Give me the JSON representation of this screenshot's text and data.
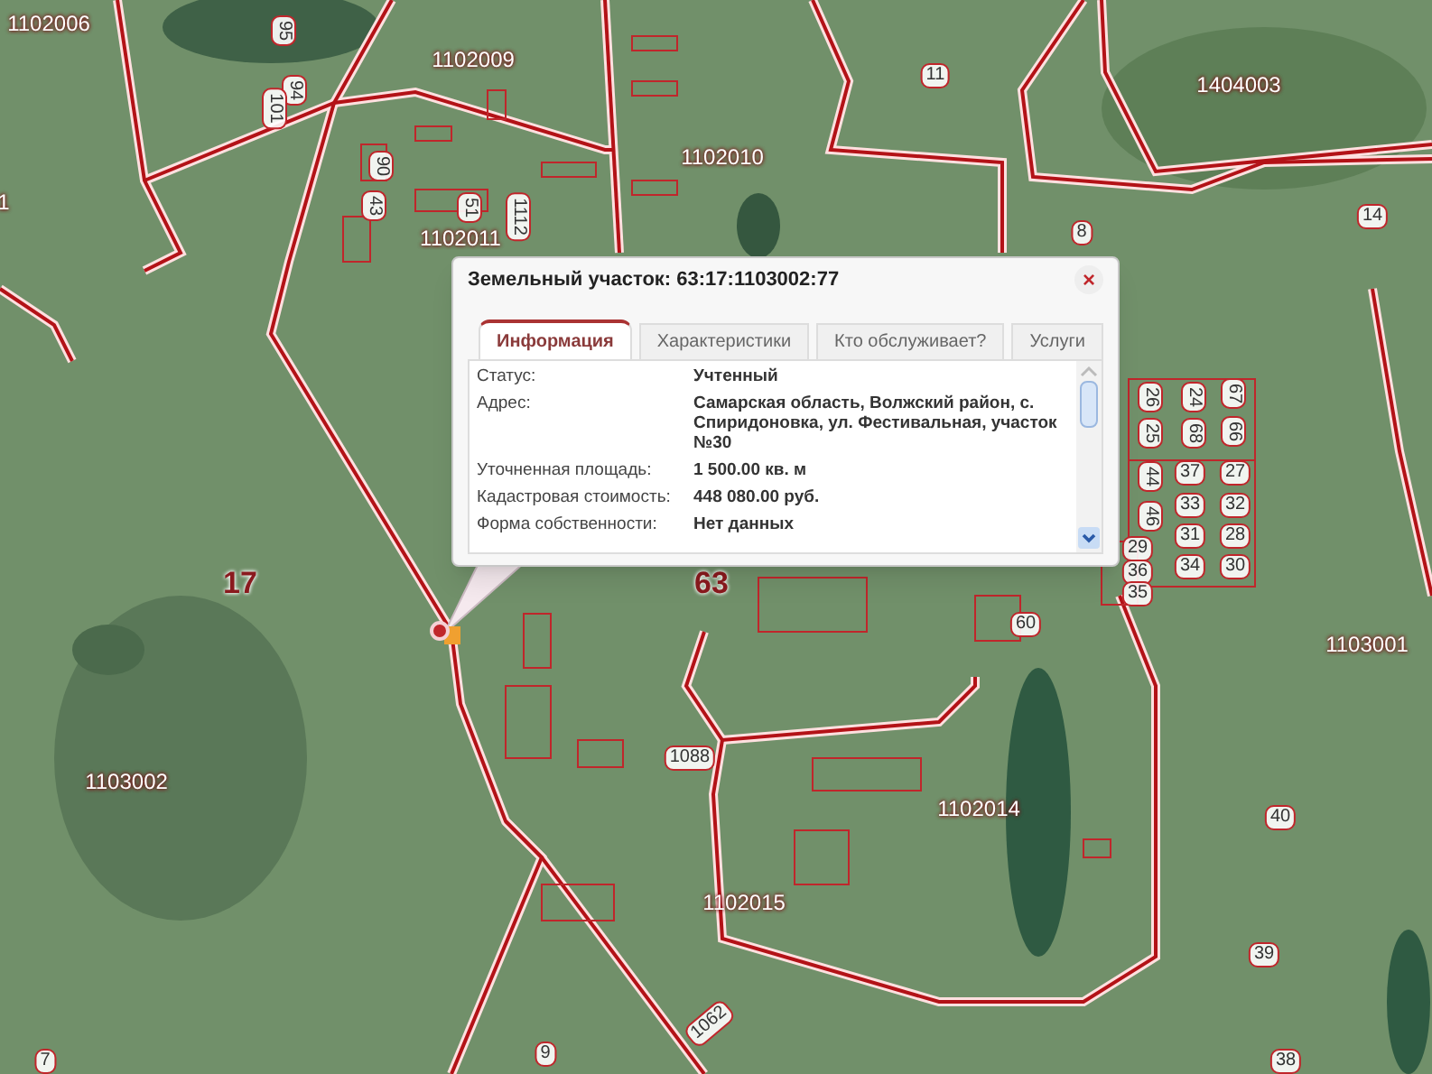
{
  "map": {
    "labels": [
      {
        "text": "1102006",
        "kind": "block"
      },
      {
        "text": "95",
        "kind": "parcel"
      },
      {
        "text": "94",
        "kind": "parcel"
      },
      {
        "text": "101",
        "kind": "parcel"
      },
      {
        "text": "1102009",
        "kind": "block"
      },
      {
        "text": "1102010",
        "kind": "block"
      },
      {
        "text": "11",
        "kind": "parcel"
      },
      {
        "text": "1404003",
        "kind": "block"
      },
      {
        "text": "1",
        "kind": "block"
      },
      {
        "text": "90",
        "kind": "parcel"
      },
      {
        "text": "43",
        "kind": "parcel"
      },
      {
        "text": "51",
        "kind": "parcel"
      },
      {
        "text": "1112",
        "kind": "parcel"
      },
      {
        "text": "1102011",
        "kind": "block"
      },
      {
        "text": "8",
        "kind": "parcel"
      },
      {
        "text": "14",
        "kind": "parcel"
      },
      {
        "text": "26",
        "kind": "parcel"
      },
      {
        "text": "24",
        "kind": "parcel"
      },
      {
        "text": "67",
        "kind": "parcel"
      },
      {
        "text": "25",
        "kind": "parcel"
      },
      {
        "text": "68",
        "kind": "parcel"
      },
      {
        "text": "66",
        "kind": "parcel"
      },
      {
        "text": "44",
        "kind": "parcel"
      },
      {
        "text": "37",
        "kind": "parcel"
      },
      {
        "text": "27",
        "kind": "parcel"
      },
      {
        "text": "46",
        "kind": "parcel"
      },
      {
        "text": "33",
        "kind": "parcel"
      },
      {
        "text": "32",
        "kind": "parcel"
      },
      {
        "text": "31",
        "kind": "parcel"
      },
      {
        "text": "28",
        "kind": "parcel"
      },
      {
        "text": "29",
        "kind": "parcel"
      },
      {
        "text": "34",
        "kind": "parcel"
      },
      {
        "text": "30",
        "kind": "parcel"
      },
      {
        "text": "36",
        "kind": "parcel"
      },
      {
        "text": "35",
        "kind": "parcel"
      },
      {
        "text": "17",
        "kind": "district"
      },
      {
        "text": "63",
        "kind": "district"
      },
      {
        "text": "60",
        "kind": "parcel"
      },
      {
        "text": "1103001",
        "kind": "block"
      },
      {
        "text": "1103002",
        "kind": "block"
      },
      {
        "text": "1088",
        "kind": "parcel"
      },
      {
        "text": "1102014",
        "kind": "block"
      },
      {
        "text": "40",
        "kind": "parcel"
      },
      {
        "text": "1102015",
        "kind": "block"
      },
      {
        "text": "39",
        "kind": "parcel"
      },
      {
        "text": "1062",
        "kind": "parcel"
      },
      {
        "text": "7",
        "kind": "parcel"
      },
      {
        "text": "9",
        "kind": "parcel"
      },
      {
        "text": "38",
        "kind": "parcel"
      }
    ]
  },
  "popup": {
    "title": "Земельный участок: 63:17:1103002:77",
    "close": "×",
    "tabs": [
      {
        "label": "Информация",
        "selected": true
      },
      {
        "label": "Характеристики",
        "selected": false
      },
      {
        "label": "Кто обслуживает?",
        "selected": false
      },
      {
        "label": "Услуги",
        "selected": false
      }
    ],
    "rows": [
      {
        "label": "Статус:",
        "value": "Учтенный"
      },
      {
        "label": "Адрес:",
        "value": "Самарская область, Волжский район, с. Спиридоновка, ул. Фестивальная, участок №30"
      },
      {
        "label": "Уточненная площадь:",
        "value": "1 500.00 кв. м"
      },
      {
        "label": "Кадастровая стоимость:",
        "value": "448 080.00 руб."
      },
      {
        "label": "Форма собственности:",
        "value": "Нет данных"
      }
    ]
  }
}
